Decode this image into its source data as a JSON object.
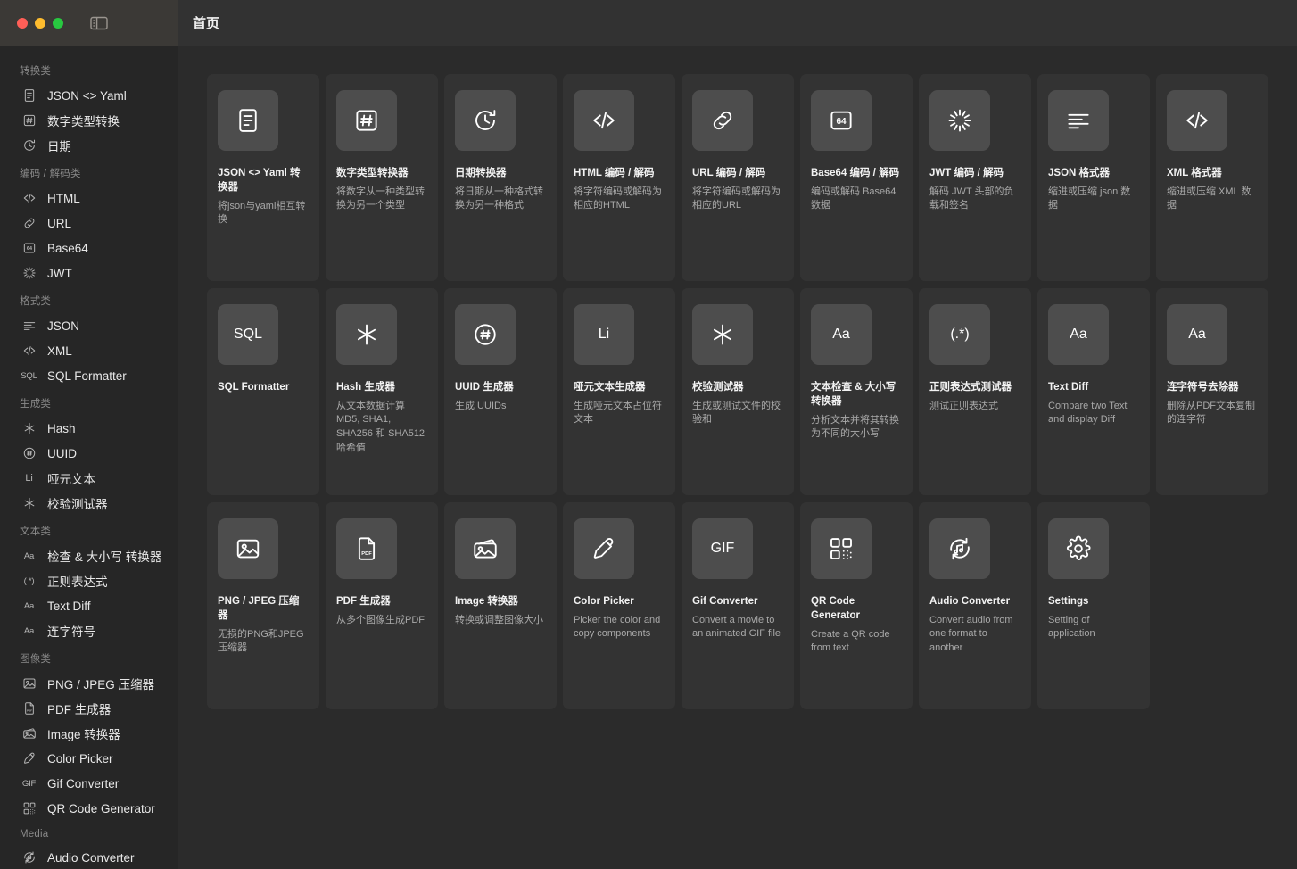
{
  "window": {
    "traffic_lights": [
      "close",
      "minimize",
      "zoom"
    ],
    "sidebar_toggle_icon": "sidebar-toggle-icon"
  },
  "header": {
    "title": "首页"
  },
  "sidebar": {
    "sections": [
      {
        "title": "转换类",
        "items": [
          {
            "label": "JSON <> Yaml",
            "icon": "document-icon"
          },
          {
            "label": "数字类型转换",
            "icon": "hash-box-icon"
          },
          {
            "label": "日期",
            "icon": "clock-rotate-icon"
          }
        ]
      },
      {
        "title": "编码 / 解码类",
        "items": [
          {
            "label": "HTML",
            "icon": "code-icon"
          },
          {
            "label": "URL",
            "icon": "link-icon"
          },
          {
            "label": "Base64",
            "icon": "base64-box-icon"
          },
          {
            "label": "JWT",
            "icon": "spinner-icon"
          }
        ]
      },
      {
        "title": "格式类",
        "items": [
          {
            "label": "JSON",
            "icon": "align-left-icon"
          },
          {
            "label": "XML",
            "icon": "code-icon"
          },
          {
            "label": "SQL Formatter",
            "icon": "sql-text-icon"
          }
        ]
      },
      {
        "title": "生成类",
        "items": [
          {
            "label": "Hash",
            "icon": "asterisk-icon"
          },
          {
            "label": "UUID",
            "icon": "hash-circle-icon"
          },
          {
            "label": "哑元文本",
            "icon": "li-text-icon"
          },
          {
            "label": "校验测试器",
            "icon": "asterisk-icon"
          }
        ]
      },
      {
        "title": "文本类",
        "items": [
          {
            "label": "检查 & 大小写 转换器",
            "icon": "aa-text-icon"
          },
          {
            "label": "正则表达式",
            "icon": "regex-text-icon"
          },
          {
            "label": "Text Diff",
            "icon": "aa-text-icon"
          },
          {
            "label": "连字符号",
            "icon": "aa-text-icon"
          }
        ]
      },
      {
        "title": "图像类",
        "items": [
          {
            "label": "PNG / JPEG 压缩器",
            "icon": "image-icon"
          },
          {
            "label": "PDF 生成器",
            "icon": "pdf-file-icon"
          },
          {
            "label": "Image 转换器",
            "icon": "images-stack-icon"
          },
          {
            "label": "Color Picker",
            "icon": "eyedropper-icon"
          },
          {
            "label": "Gif Converter",
            "icon": "gif-text-icon"
          },
          {
            "label": "QR Code Generator",
            "icon": "qrcode-icon"
          }
        ]
      },
      {
        "title": "Media",
        "items": [
          {
            "label": "Audio Converter",
            "icon": "audio-convert-icon"
          }
        ]
      }
    ]
  },
  "main": {
    "cards": [
      {
        "title": "JSON <> Yaml 转换器",
        "desc": "将json与yaml相互转换",
        "icon": "document-icon"
      },
      {
        "title": "数字类型转换器",
        "desc": "将数字从一种类型转换为另一个类型",
        "icon": "hash-box-icon"
      },
      {
        "title": "日期转换器",
        "desc": "将日期从一种格式转换为另一种格式",
        "icon": "clock-rotate-icon"
      },
      {
        "title": "HTML 编码 / 解码",
        "desc": "将字符编码或解码为相应的HTML",
        "icon": "code-icon"
      },
      {
        "title": "URL 编码 / 解码",
        "desc": "将字符编码或解码为相应的URL",
        "icon": "link-icon"
      },
      {
        "title": "Base64 编码 / 解码",
        "desc": "编码或解码 Base64 数据",
        "icon": "base64-box-icon"
      },
      {
        "title": "JWT 编码 / 解码",
        "desc": "解码 JWT 头部的负载和签名",
        "icon": "spinner-icon"
      },
      {
        "title": "JSON 格式器",
        "desc": "缩进或压缩 json 数据",
        "icon": "align-left-icon"
      },
      {
        "title": "XML 格式器",
        "desc": "缩进或压缩 XML 数据",
        "icon": "code-icon"
      },
      {
        "title": "SQL Formatter",
        "desc": "",
        "icon": "sql-text-icon"
      },
      {
        "title": "Hash 生成器",
        "desc": "从文本数据计算 MD5, SHA1, SHA256 和 SHA512 哈希值",
        "icon": "asterisk-icon"
      },
      {
        "title": "UUID 生成器",
        "desc": "生成 UUIDs",
        "icon": "hash-circle-icon"
      },
      {
        "title": "哑元文本生成器",
        "desc": "生成哑元文本占位符文本",
        "icon": "li-text-icon"
      },
      {
        "title": "校验测试器",
        "desc": "生成或测试文件的校验和",
        "icon": "asterisk-icon"
      },
      {
        "title": "文本检查 & 大小写转换器",
        "desc": "分析文本并将其转换为不同的大小写",
        "icon": "aa-text-icon"
      },
      {
        "title": "正则表达式测试器",
        "desc": "测试正则表达式",
        "icon": "regex-text-icon"
      },
      {
        "title": "Text Diff",
        "desc": "Compare two Text and display Diff",
        "icon": "aa-text-icon"
      },
      {
        "title": "连字符号去除器",
        "desc": "删除从PDF文本复制的连字符",
        "icon": "aa-text-icon"
      },
      {
        "title": "PNG / JPEG 压缩器",
        "desc": "无损的PNG和JPEG压缩器",
        "icon": "image-icon"
      },
      {
        "title": "PDF 生成器",
        "desc": "从多个图像生成PDF",
        "icon": "pdf-file-icon"
      },
      {
        "title": "Image 转换器",
        "desc": "转换或调整图像大小",
        "icon": "images-stack-icon"
      },
      {
        "title": "Color Picker",
        "desc": "Picker the color and copy components",
        "icon": "eyedropper-icon"
      },
      {
        "title": "Gif Converter",
        "desc": "Convert a movie to an animated GIF file",
        "icon": "gif-text-icon"
      },
      {
        "title": "QR Code Generator",
        "desc": "Create a QR code from text",
        "icon": "qrcode-icon"
      },
      {
        "title": "Audio Converter",
        "desc": "Convert audio from one format to another",
        "icon": "audio-convert-icon"
      },
      {
        "title": "Settings",
        "desc": "Setting of application",
        "icon": "gear-icon"
      }
    ]
  },
  "colors": {
    "window_bg": "#2b2b2b",
    "sidebar_bg": "#262626",
    "titlebar_bg": "#3b3936",
    "topbar_bg": "#323232",
    "card_bg": "#333333",
    "card_icon_bg": "#4d4d4d",
    "text_primary": "#f2f2f2",
    "text_secondary": "#a9a9a9",
    "section_title": "#8a8a8a"
  }
}
